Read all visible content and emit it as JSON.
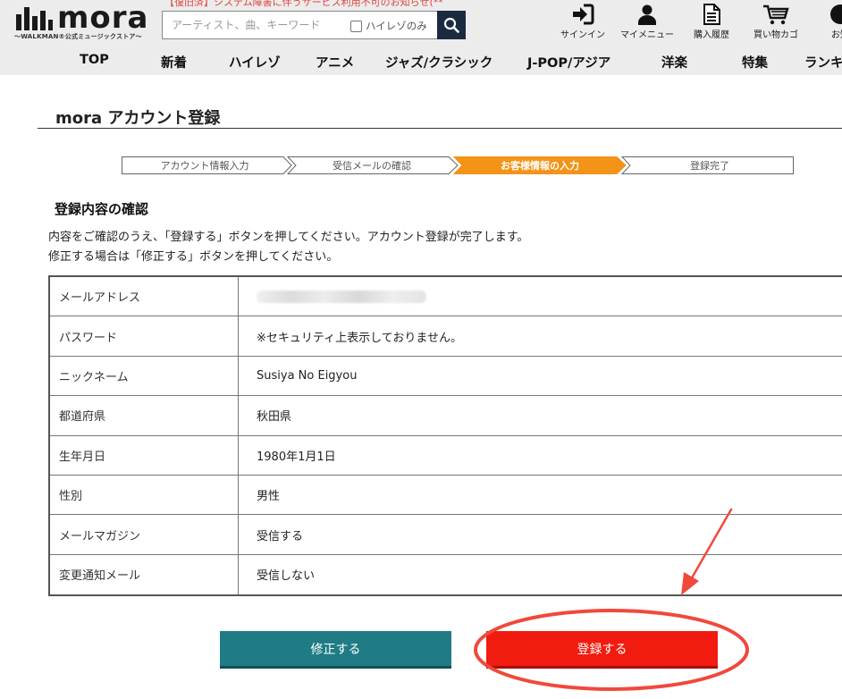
{
  "header": {
    "logo_word": "mora",
    "logo_sub": "〜WALKMAN®公式ミュージックストア〜",
    "notice": "【復旧済】システム障害に伴うサービス利用不可のお知らせ(**",
    "search": {
      "placeholder": "アーティスト、曲、キーワード",
      "hires_label": "ハイレゾのみ"
    },
    "icons": [
      {
        "name": "signin-icon",
        "label": "サインイン"
      },
      {
        "name": "user-icon",
        "label": "マイメニュー"
      },
      {
        "name": "document-icon",
        "label": "購入履歴"
      },
      {
        "name": "cart-icon",
        "label": "買い物カゴ"
      },
      {
        "name": "info-icon",
        "label": "お知"
      }
    ]
  },
  "nav": [
    "TOP",
    "新着",
    "ハイレゾ",
    "アニメ",
    "ジャズ/クラシック",
    "J-POP/アジア",
    "洋楽",
    "特集",
    "ランキ"
  ],
  "page": {
    "title": "mora アカウント登録",
    "steps": [
      "アカウント情報入力",
      "受信メールの確認",
      "お客様情報の入力",
      "登録完了"
    ],
    "active_step": 2,
    "section_head": "登録内容の確認",
    "desc1": "内容をご確認のうえ、「登録する」ボタンを押してください。アカウント登録が完了します。",
    "desc2": "修正する場合は「修正する」ボタンを押してください。",
    "rows": [
      {
        "label": "メールアドレス",
        "value": ""
      },
      {
        "label": "パスワード",
        "value": "※セキュリティ上表示しておりません。"
      },
      {
        "label": "ニックネーム",
        "value": "Susiya No Eigyou"
      },
      {
        "label": "都道府県",
        "value": "秋田県"
      },
      {
        "label": "生年月日",
        "value": "1980年1月1日"
      },
      {
        "label": "性別",
        "value": "男性"
      },
      {
        "label": "メールマガジン",
        "value": "受信する"
      },
      {
        "label": "変更通知メール",
        "value": "受信しない"
      }
    ],
    "btn_fix": "修正する",
    "btn_register": "登録する"
  },
  "colors": {
    "accent_orange": "#f39318",
    "fix_button": "#1f7c85",
    "register_button": "#f21b0f",
    "annotation": "#f0493c"
  }
}
